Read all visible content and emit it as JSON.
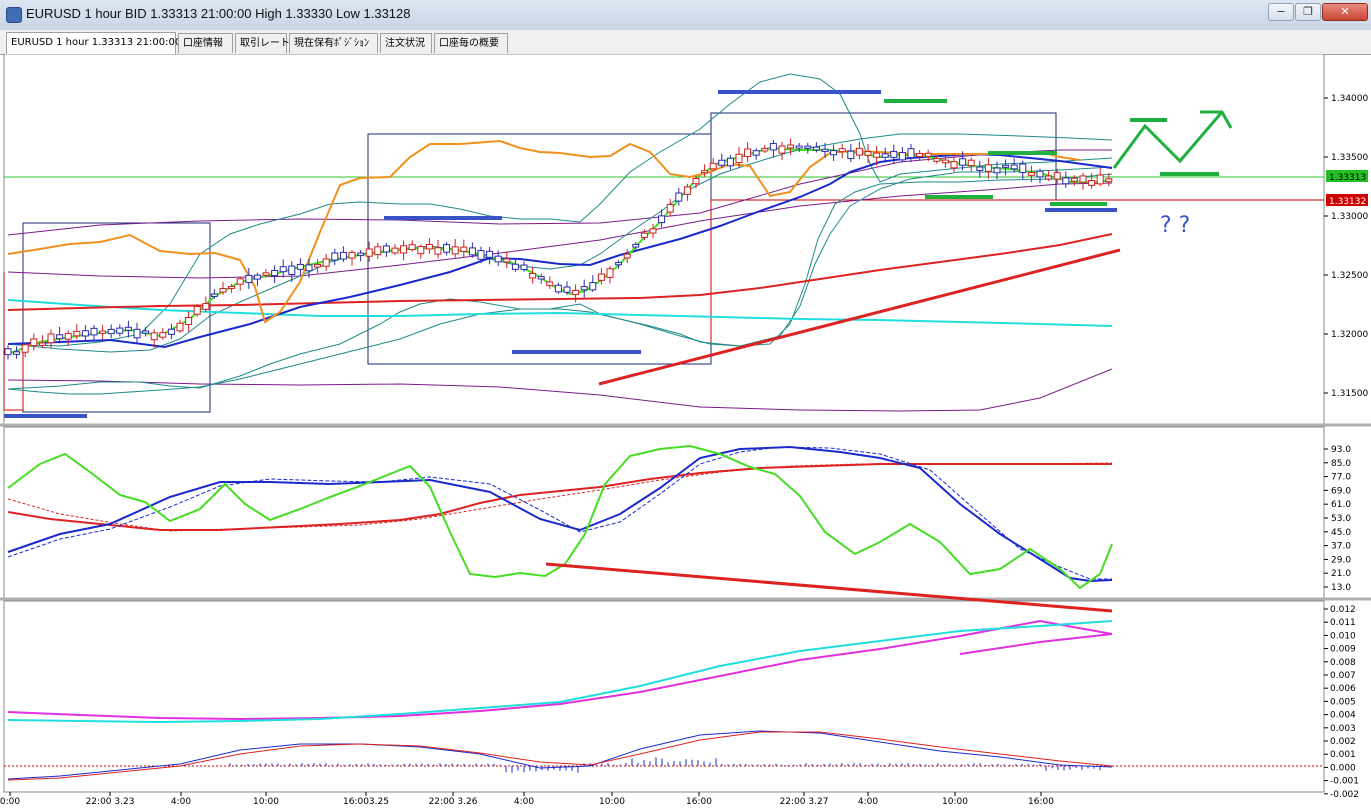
{
  "window": {
    "title": "EURUSD 1 hour BID 1.33313 21:00:00 High 1.33330 Low 1.33128",
    "buttons": {
      "minimize": "−",
      "restore": "❐",
      "close": "✕"
    }
  },
  "tabs": [
    {
      "label": "EURUSD 1 hour 1.33313 21:00:00"
    },
    {
      "label": "口座情報"
    },
    {
      "label": "取引レート"
    },
    {
      "label": "現在保有ﾎﾟｼﾞｼｮﾝ"
    },
    {
      "label": "注文状況"
    },
    {
      "label": "口座毎の概要"
    }
  ],
  "annotation_marks": "? ?",
  "price_panel": {
    "ticks": [
      "1.34000",
      "1.33500",
      "1.33000",
      "1.32500",
      "1.32000",
      "1.31500"
    ],
    "current_bid": "1.33313",
    "marker_price": "1.33132"
  },
  "oscillator_panel": {
    "ticks": [
      "93.0",
      "85.0",
      "77.0",
      "69.0",
      "61.0",
      "53.0",
      "45.0",
      "37.0",
      "29.0",
      "21.0",
      "13.0"
    ]
  },
  "macd_panel": {
    "ticks": [
      "0.012",
      "0.011",
      "0.010",
      "0.009",
      "0.008",
      "0.007",
      "0.006",
      "0.005",
      "0.004",
      "0.003",
      "0.002",
      "0.001",
      "0.000",
      "-0.001",
      "-0.002"
    ]
  },
  "time_axis": [
    "0:00",
    "22:00 3.23",
    "4:00",
    "10:00",
    "16:003.25",
    "22:00 3.26",
    "4:00",
    "10:00",
    "16:00",
    "22:00 3.27",
    "4:00",
    "10:00",
    "16:00"
  ],
  "colors": {
    "candle_up": "#2a2ab0",
    "candle_down": "#d02020",
    "ma_fast": "#44dd22",
    "ma_mid": "#1a2acc",
    "ma_slow": "#dd2222",
    "bands": "#1f8a8a",
    "envelope": "#7a1a8a",
    "cyan": "#22dddd",
    "orange": "#f0901e",
    "magenta": "#e030e0",
    "marker_red": "#d00000",
    "bid_green": "#20c020"
  }
}
